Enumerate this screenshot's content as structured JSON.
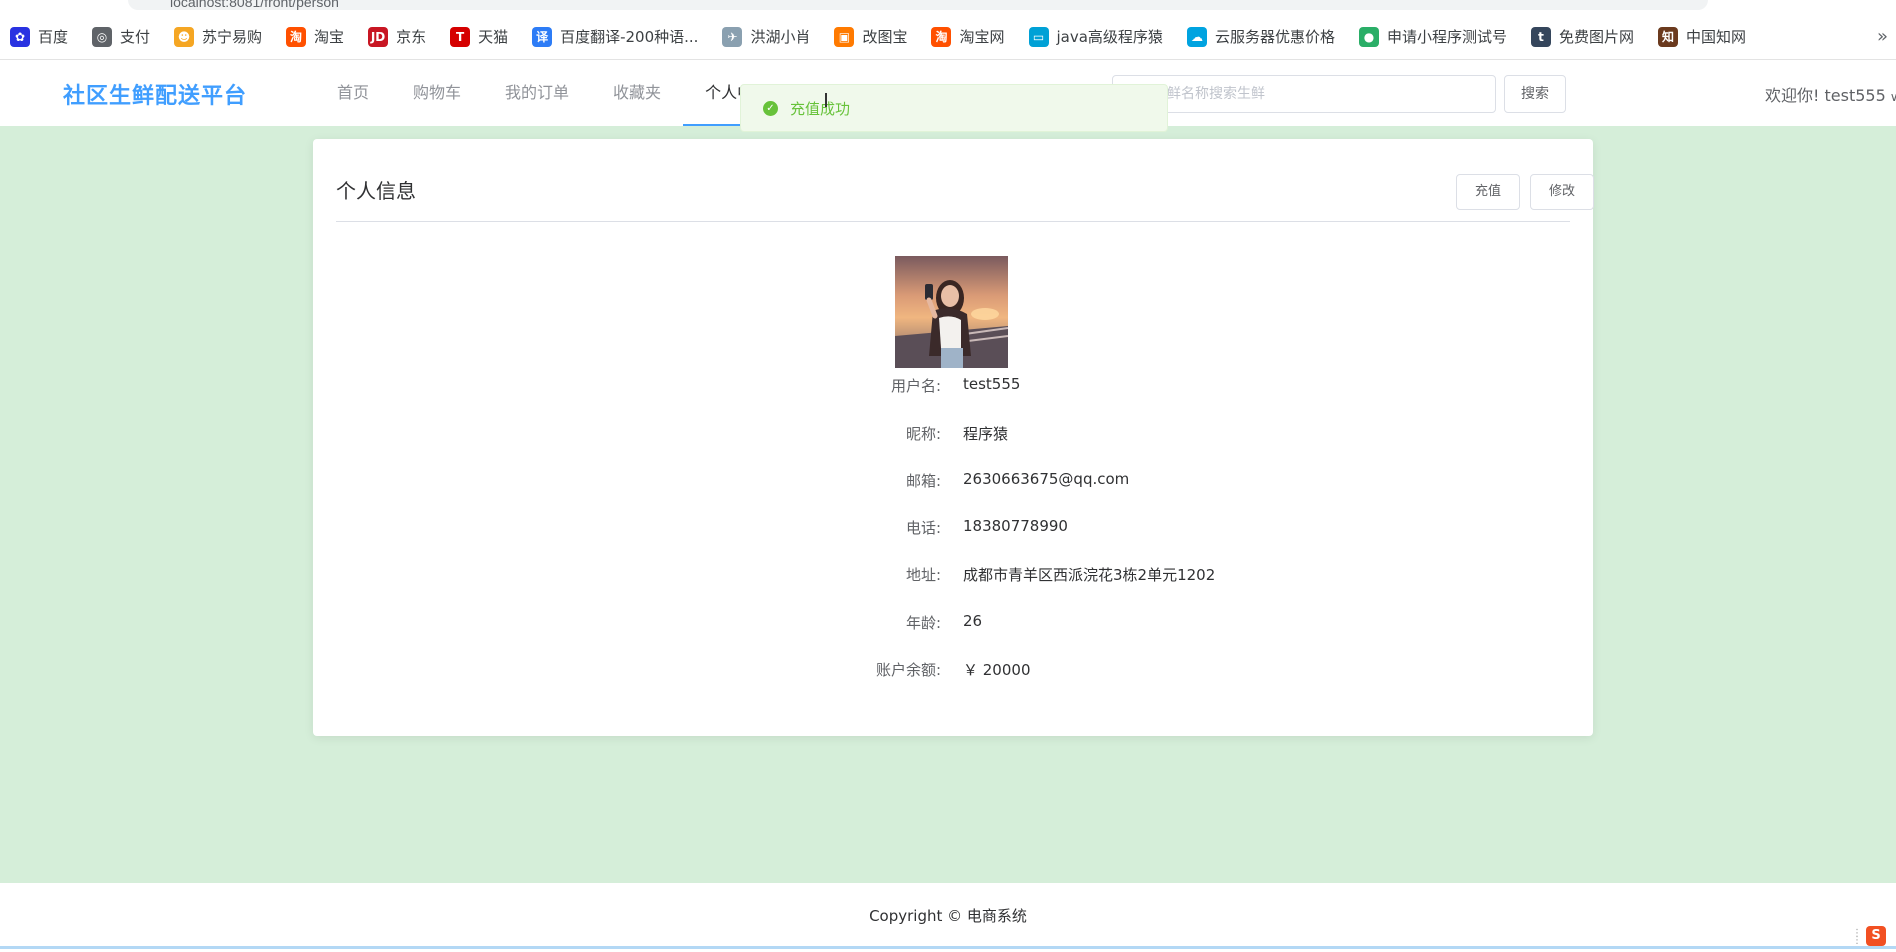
{
  "browser": {
    "url": "localhost:8081/front/person"
  },
  "bookmarks": [
    {
      "label": "百度",
      "icon": "baidu-icon",
      "color": "#2932e1",
      "glyph": "✿"
    },
    {
      "label": "支付",
      "icon": "pay-icon",
      "color": "#5f6368",
      "glyph": "◎"
    },
    {
      "label": "苏宁易购",
      "icon": "suning-icon",
      "color": "#f5a623",
      "glyph": "☻"
    },
    {
      "label": "淘宝",
      "icon": "taobao-icon",
      "color": "#ff5000",
      "glyph": "淘"
    },
    {
      "label": "京东",
      "icon": "jd-icon",
      "color": "#c81623",
      "glyph": "JD"
    },
    {
      "label": "天猫",
      "icon": "tmall-icon",
      "color": "#d50000",
      "glyph": "T"
    },
    {
      "label": "百度翻译-200种语...",
      "icon": "baidu-translate-icon",
      "color": "#2d7cf6",
      "glyph": "译"
    },
    {
      "label": "洪湖小肖",
      "icon": "bird-icon",
      "color": "#8aa0b0",
      "glyph": "✈"
    },
    {
      "label": "改图宝",
      "icon": "gaitubao-icon",
      "color": "#ff7a00",
      "glyph": "▣"
    },
    {
      "label": "淘宝网",
      "icon": "taobao-net-icon",
      "color": "#ff5000",
      "glyph": "淘"
    },
    {
      "label": "java高级程序猿",
      "icon": "bilibili-icon",
      "color": "#00a1d6",
      "glyph": "▭"
    },
    {
      "label": "云服务器优惠价格",
      "icon": "cloud-icon",
      "color": "#00a3e0",
      "glyph": "☁"
    },
    {
      "label": "申请小程序测试号",
      "icon": "wechat-icon",
      "color": "#2aae67",
      "glyph": "●"
    },
    {
      "label": "免费图片网",
      "icon": "tumblr-icon",
      "color": "#35465c",
      "glyph": "t"
    },
    {
      "label": "中国知网",
      "icon": "cnki-icon",
      "color": "#6b3a1e",
      "glyph": "知"
    }
  ],
  "header": {
    "logo": "社区生鲜配送平台",
    "nav": [
      {
        "label": "首页",
        "active": false
      },
      {
        "label": "购物车",
        "active": false
      },
      {
        "label": "我的订单",
        "active": false
      },
      {
        "label": "收藏夹",
        "active": false
      },
      {
        "label": "个人中心",
        "active": true
      }
    ],
    "search_placeholder": "输入生鲜名称搜索生鲜",
    "search_button": "搜索",
    "welcome": "欢迎你!  test555"
  },
  "toast": {
    "text": "充值成功",
    "type": "success"
  },
  "card": {
    "title": "个人信息",
    "recharge_button": "充值",
    "edit_button": "修改"
  },
  "profile": [
    {
      "label": "用户名:",
      "value": "test555"
    },
    {
      "label": "昵称:",
      "value": "程序猿"
    },
    {
      "label": "邮箱:",
      "value": "2630663675@qq.com"
    },
    {
      "label": "电话:",
      "value": "18380778990"
    },
    {
      "label": "地址:",
      "value": "成都市青羊区西派浣花3栋2单元1202"
    },
    {
      "label": "年龄:",
      "value": "26"
    },
    {
      "label": "账户余额:",
      "value": "￥ 20000"
    }
  ],
  "footer": {
    "text": "Copyright © 电商系统"
  },
  "colors": {
    "primary": "#409eff",
    "success": "#67c23a",
    "page_bg": "#d5eed9"
  }
}
